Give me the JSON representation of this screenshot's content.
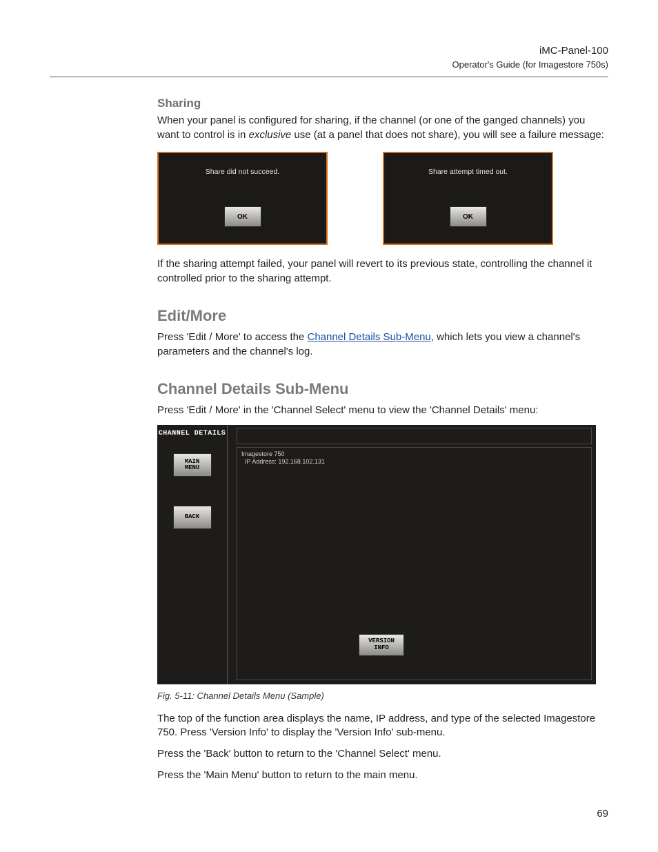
{
  "header": {
    "title": "iMC-Panel-100",
    "subtitle": "Operator's Guide (for Imagestore 750s)"
  },
  "sharing": {
    "heading": "Sharing",
    "para1_a": "When your panel is configured for sharing, if the channel (or one of the ganged channels) you want to control is in ",
    "para1_em": "exclusive",
    "para1_b": " use (at a panel that does not share), you will see a failure message:",
    "dialog1_msg": "Share did not succeed.",
    "dialog2_msg": "Share attempt timed out.",
    "ok_label": "OK",
    "para2": "If the sharing attempt failed, your panel will revert to its previous state, controlling the channel it controlled prior to the sharing attempt."
  },
  "edit_more": {
    "heading": "Edit/More",
    "para_a": "Press 'Edit / More' to access the ",
    "link": "Channel Details Sub-Menu",
    "para_b": ", which lets you view a channel's parameters and the channel's log."
  },
  "channel_details": {
    "heading": "Channel Details Sub-Menu",
    "intro": "Press 'Edit / More' in the 'Channel Select' menu to view the 'Channel Details' menu:",
    "panel": {
      "title": "CHANNEL\nDETAILS",
      "main_menu_btn": "MAIN\nMENU",
      "back_btn": "BACK",
      "info_text": "Imagestore 750\n  IP Address: 192.168.102.131",
      "version_btn": "VERSION\nINFO"
    },
    "caption": "Fig. 5-11: Channel Details Menu (Sample)",
    "p1": "The top of the function area displays the name, IP address, and type of the selected Imagestore 750. Press 'Version Info' to display the 'Version Info' sub-menu.",
    "p2": "Press the 'Back' button to return to the 'Channel Select' menu.",
    "p3": "Press the 'Main Menu' button to return to the main menu."
  },
  "page_number": "69"
}
